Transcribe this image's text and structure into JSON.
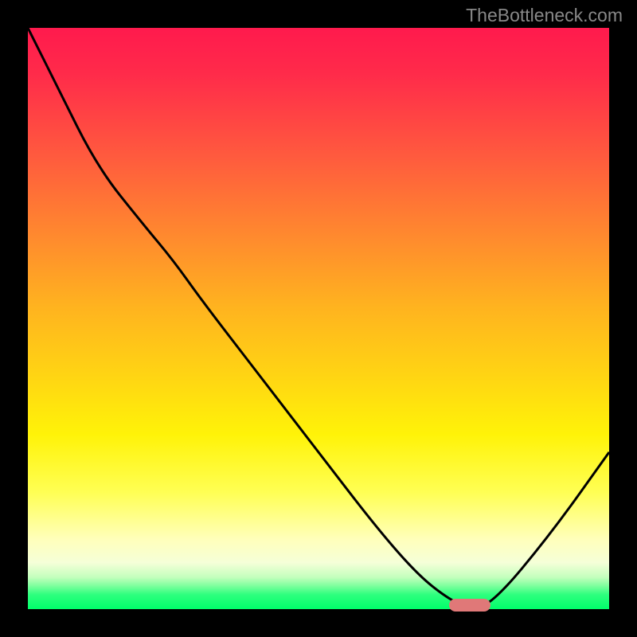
{
  "watermark": "TheBottleneck.com",
  "chart_data": {
    "type": "line",
    "title": "",
    "xlabel": "",
    "ylabel": "",
    "x": [
      0.0,
      0.05,
      0.12,
      0.2,
      0.25,
      0.3,
      0.4,
      0.5,
      0.6,
      0.67,
      0.72,
      0.76,
      0.8,
      0.9,
      1.0
    ],
    "y": [
      1.0,
      0.9,
      0.76,
      0.66,
      0.6,
      0.53,
      0.4,
      0.27,
      0.14,
      0.06,
      0.02,
      0.0,
      0.01,
      0.13,
      0.27
    ],
    "xlim": [
      0,
      1
    ],
    "ylim": [
      0,
      1
    ],
    "sweet_spot_x": 0.76,
    "marker": {
      "x": 0.76,
      "y": 0.0
    }
  },
  "colors": {
    "curve": "#000000",
    "marker": "#e07878",
    "frame": "#000000"
  }
}
